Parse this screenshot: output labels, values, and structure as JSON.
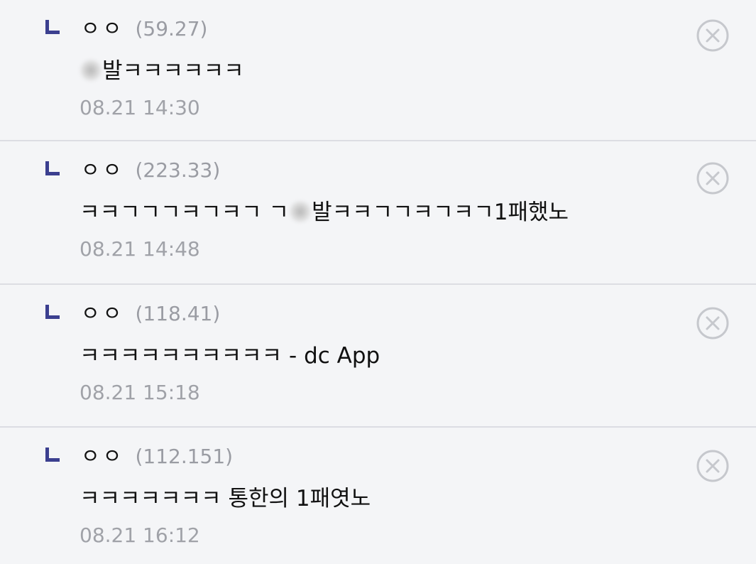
{
  "colors": {
    "background": "#f4f5f7",
    "reply_arrow": "#3b3f8f",
    "meta_gray": "#a0a2a8",
    "divider": "#dcdde3"
  },
  "icons": {
    "reply": "reply-arrow-icon",
    "delete": "circle-x-icon"
  },
  "replies": [
    {
      "nickname": "ㅇㅇ",
      "ip": "(59.27)",
      "content_before": "",
      "content_after": "발ㅋㅋㅋㅋㅋㅋ",
      "date": "08.21 14:30"
    },
    {
      "nickname": "ㅇㅇ",
      "ip": "(223.33)",
      "content_before": "ㅋㅋㄱㄱㄱㅋㄱㅋㄱ ㄱ",
      "content_after": "발ㅋㅋㄱㄱㅋㄱㅋㄱ1패했노",
      "date": "08.21 14:48"
    },
    {
      "nickname": "ㅇㅇ",
      "ip": "(118.41)",
      "content": "ㅋㅋㅋㅋㅋㅋㅋㅋㅋㅋ - dc App",
      "date": "08.21 15:18"
    },
    {
      "nickname": "ㅇㅇ",
      "ip": "(112.151)",
      "content": "ㅋㅋㅋㅋㅋㅋㅋ 통한의 1패엿노",
      "date": "08.21 16:12"
    }
  ]
}
